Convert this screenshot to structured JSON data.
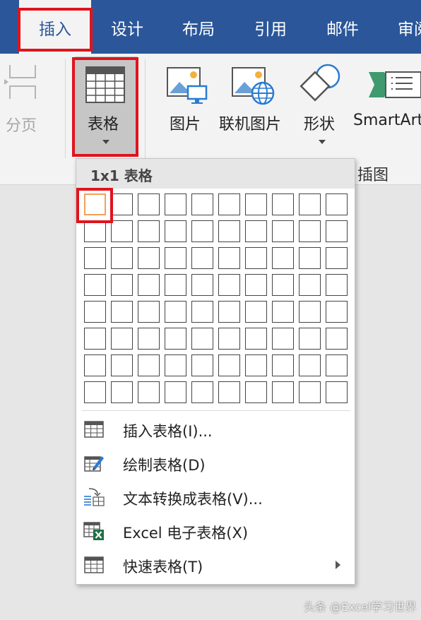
{
  "tabs": [
    {
      "label": "插入",
      "active": true
    },
    {
      "label": "设计",
      "active": false
    },
    {
      "label": "布局",
      "active": false
    },
    {
      "label": "引用",
      "active": false
    },
    {
      "label": "邮件",
      "active": false
    },
    {
      "label": "审阅",
      "active": false
    }
  ],
  "ribbon": {
    "page_break_label": "分页",
    "table_label": "表格",
    "picture_label": "图片",
    "online_picture_label": "联机图片",
    "shapes_label": "形状",
    "smartart_label": "SmartArt",
    "group_label": "插图"
  },
  "dropdown": {
    "header": "1x1 表格",
    "grid": {
      "columns": 10,
      "rows": 8,
      "selected_columns": 1,
      "selected_rows": 1
    },
    "items": [
      {
        "label": "插入表格(I)...",
        "icon": "insert-table-icon",
        "submenu": false
      },
      {
        "label": "绘制表格(D)",
        "icon": "draw-table-icon",
        "submenu": false
      },
      {
        "label": "文本转换成表格(V)...",
        "icon": "convert-text-to-table-icon",
        "submenu": false
      },
      {
        "label": "Excel 电子表格(X)",
        "icon": "excel-spreadsheet-icon",
        "submenu": false
      },
      {
        "label": "快速表格(T)",
        "icon": "quick-tables-icon",
        "submenu": true
      }
    ]
  },
  "watermark": "头条 @Excel学习世界",
  "colors": {
    "ribbon_tab_bar": "#2b579a",
    "highlight_red": "#e0141d",
    "selected_cell": "#f1a25b"
  }
}
